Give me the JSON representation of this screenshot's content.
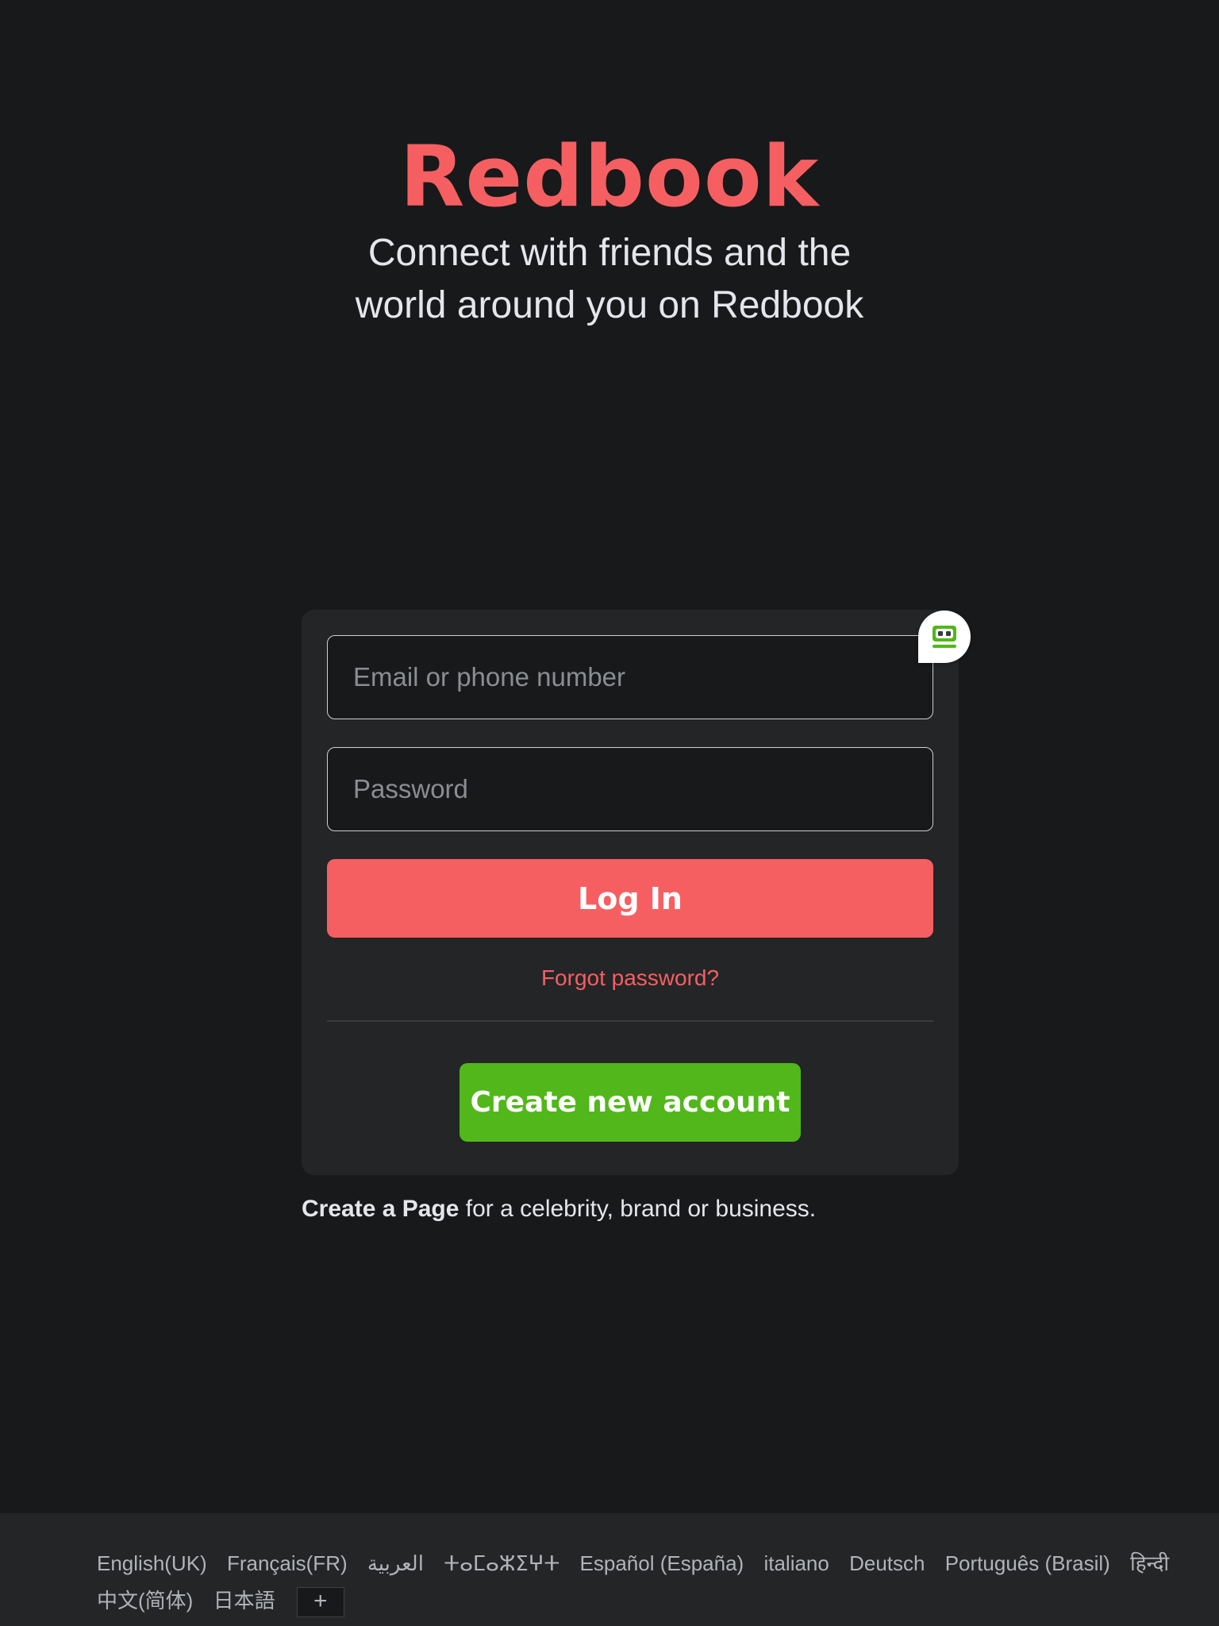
{
  "brand": {
    "logo": "Redbook",
    "tagline": "Connect with friends and the world around you on Redbook",
    "logo_color": "#f65f61"
  },
  "login_form": {
    "email_placeholder": "Email or phone number",
    "password_placeholder": "Password",
    "login_label": "Log In",
    "forgot_label": "Forgot password?",
    "create_account_label": "Create new account",
    "login_color": "#f65f61",
    "create_color": "#51b71a"
  },
  "password_manager": {
    "icon": "password-manager-icon"
  },
  "create_page": {
    "link_label": "Create a Page",
    "rest_text": " for a celebrity, brand or business."
  },
  "footer": {
    "languages_row1": [
      "English(UK)",
      "Français(FR)",
      "العربية",
      "ⵜⴰⵎⴰⵣⵉⵖⵜ",
      "Español (España)",
      "italiano",
      "Deutsch",
      "Português (Brasil)",
      "हिन्दी"
    ],
    "languages_row2": [
      "中文(简体)",
      "日本語"
    ],
    "more_label": "+"
  }
}
